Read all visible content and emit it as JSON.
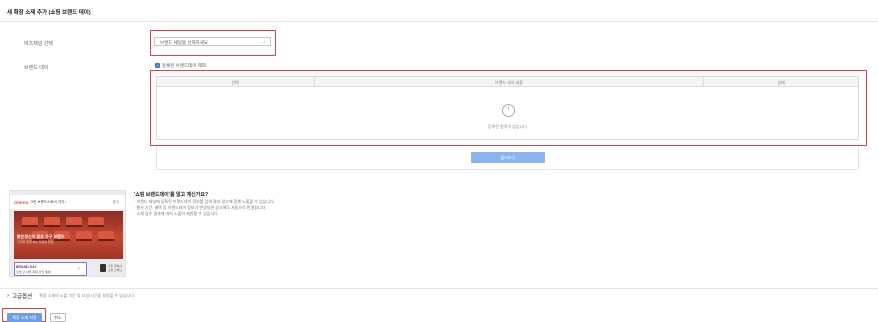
{
  "header": {
    "title": "새 확장 소재 추가 (쇼핑 브랜드 데이)"
  },
  "form": {
    "bizchannel_label": "비즈채널 선택",
    "bizchannel_value": "브랜드 채널을 선택하세요",
    "brandday_label": "브랜드 데이",
    "checkbox_label": "등록된 브랜드데이 제외",
    "checkbox_checked": true
  },
  "table": {
    "columns": [
      "선택",
      "브랜드 데이 내용",
      "상태"
    ],
    "empty_text": "등록된 항목이 없습니다.",
    "add_button": "불러오기"
  },
  "preview": {
    "brand": "GREEN",
    "brand_sub": "그린 브랜드스토어 가기 ›",
    "tag": "광고",
    "banner_title": "밝은정신이 맑은 가구 브랜드",
    "banner_sub": "가구와 함께 하는 따뜻한 일상",
    "card_title": "BRAND DAY",
    "card_sub": "오늘 단 하루 최대 할인 혜택",
    "mini_text_1": "가든 행복사",
    "mini_text_2": "소파 스퍼브"
  },
  "info": {
    "title": "'쇼핑 브랜드데이'를 알고 계신가요?",
    "lines": [
      "· 브랜드 채널에 등록된 브랜드데이 정보를 검색 결과 광고에 함께 노출할 수 있습니다.",
      "· 행사 기간, 혜택 등 브랜드데이 정보가 변경되면 광고에도 자동으로 반영됩니다.",
      "· 소재 검수 결과에 따라 노출이 제한될 수 있습니다."
    ]
  },
  "advanced": {
    "arrow": "›",
    "label": "고급옵션",
    "desc": "확장 소재의 노출 기간 및 요일/시간을 설정할 수 있습니다."
  },
  "actions": {
    "save": "확장 소재 저장",
    "cancel": "취소"
  },
  "colors": {
    "highlight": "#e0404a",
    "accent_blue": "#3a78d8"
  }
}
